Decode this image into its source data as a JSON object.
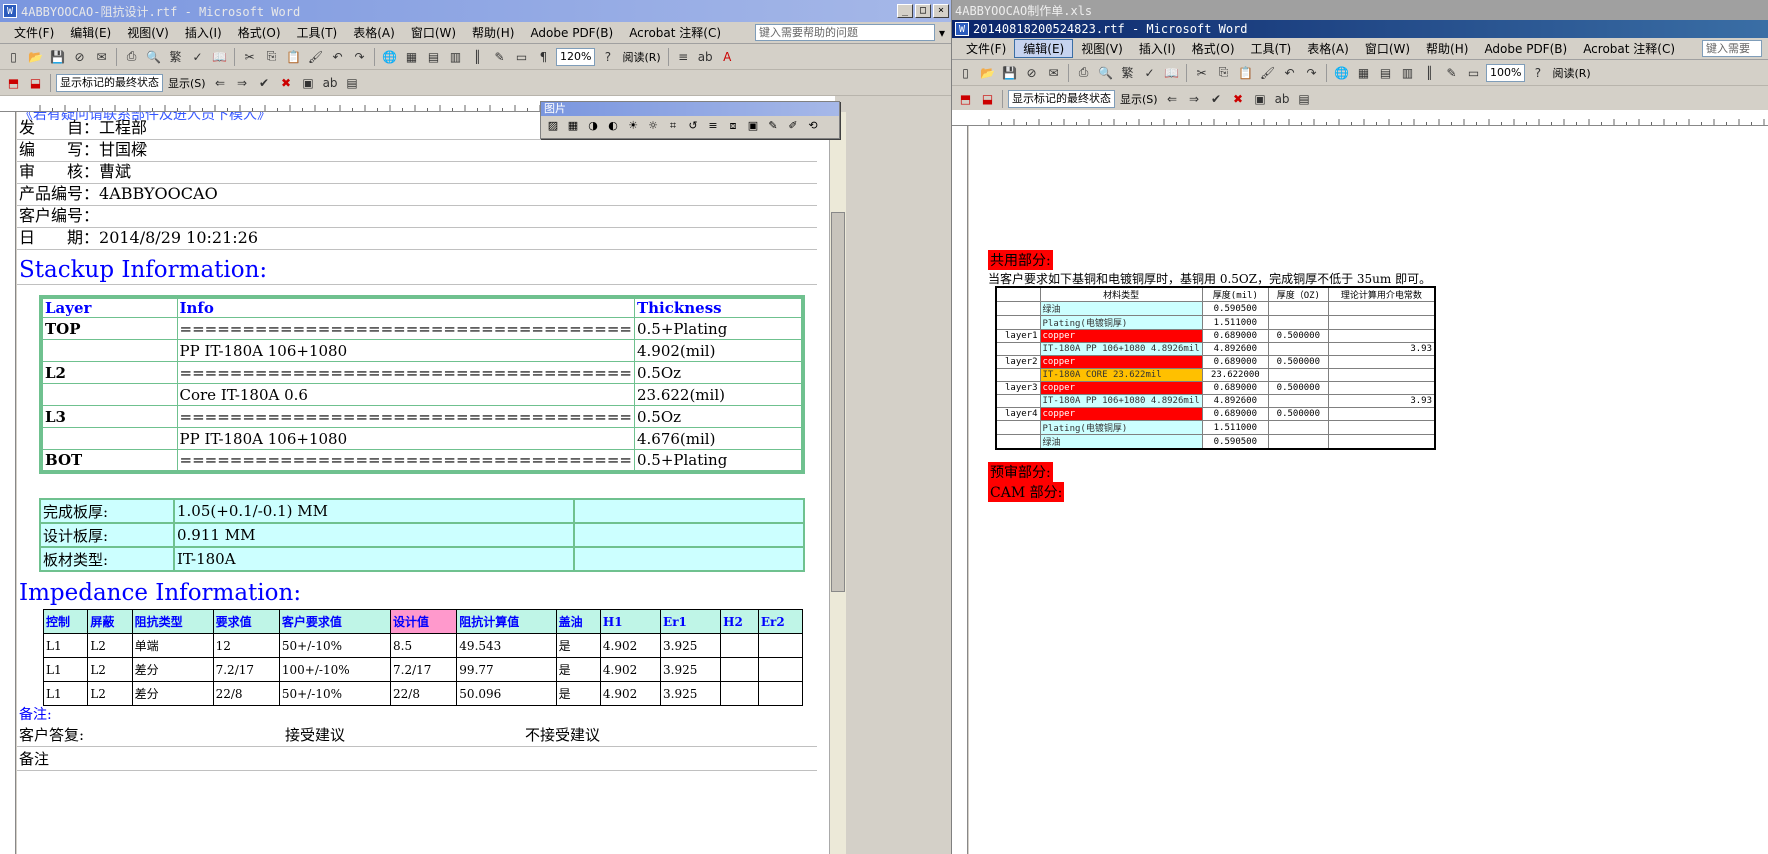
{
  "left": {
    "title": "4ABBYOOCAO-阻抗设计.rtf - Microsoft Word",
    "menu": [
      "文件(F)",
      "编辑(E)",
      "视图(V)",
      "插入(I)",
      "格式(O)",
      "工具(T)",
      "表格(A)",
      "窗口(W)",
      "帮助(H)",
      "Adobe PDF(B)",
      "Acrobat 注释(C)"
    ],
    "help_placeholder": "键入需要帮助的问题",
    "zoom": "120%",
    "read_label": "阅读(R)",
    "markup_state": "显示标记的最终状态",
    "show_label": "显示(S)",
    "top_cut": "《若有疑问请联系部件及进人员下模人》",
    "info": [
      {
        "label": "发　　自：",
        "value": "工程部"
      },
      {
        "label": "编　　写：",
        "value": "甘国樑"
      },
      {
        "label": "审　　核：",
        "value": "曹斌"
      },
      {
        "label": "产品编号：",
        "value": "4ABBYOOCAO"
      },
      {
        "label": "客户编号：",
        "value": ""
      },
      {
        "label": "日　　期：",
        "value": "2014/8/29 10:21:26"
      }
    ],
    "stackup_title": "Stackup Information:",
    "stackup_headers": [
      "Layer",
      "Info",
      "Thickness"
    ],
    "stackup_rows": [
      [
        "TOP",
        "====================================",
        "0.5+Plating"
      ],
      [
        "",
        "PP      IT-180A     106+1080",
        "4.902(mil)"
      ],
      [
        "L2",
        "====================================",
        "0.5Oz"
      ],
      [
        "",
        "Core      IT-180A     0.6",
        "23.622(mil)"
      ],
      [
        "L3",
        "====================================",
        "0.5Oz"
      ],
      [
        "",
        "PP      IT-180A     106+1080",
        "4.676(mil)"
      ],
      [
        "BOT",
        "====================================",
        "0.5+Plating"
      ]
    ],
    "board_rows": [
      [
        "完成板厚:",
        "1.05(+0.1/-0.1) MM",
        ""
      ],
      [
        "设计板厚:",
        "0.911 MM",
        ""
      ],
      [
        "板材类型:",
        "IT-180A",
        ""
      ]
    ],
    "impedance_title": "Impedance Information:",
    "imp_headers": [
      "控制",
      "屏蔽",
      "阻抗类型",
      "要求值",
      "客户要求值",
      "设计值",
      "阻抗计算值",
      "盖油",
      "H1",
      "Er1",
      "H2",
      "Er2"
    ],
    "imp_rows": [
      [
        "L1",
        "L2",
        "单端",
        "12",
        "50+/-10%",
        "8.5",
        "49.543",
        "是",
        "4.902",
        "3.925",
        "",
        ""
      ],
      [
        "L1",
        "L2",
        "差分",
        "7.2/17",
        "100+/-10%",
        "7.2/17",
        "99.77",
        "是",
        "4.902",
        "3.925",
        "",
        ""
      ],
      [
        "L1",
        "L2",
        "差分",
        "22/8",
        "50+/-10%",
        "22/8",
        "50.096",
        "是",
        "4.902",
        "3.925",
        "",
        ""
      ]
    ],
    "remark": "备注:",
    "reply_label": "客户答复:",
    "accept": "接受建议",
    "reject": "不接受建议",
    "remark2": "备注",
    "picture_toolbar_title": "图片"
  },
  "right": {
    "title": "20140818200524823.rtf - Microsoft Word",
    "bg_title": "4ABBYOOCAO制作单.xls",
    "menu": [
      "文件(F)",
      "编辑(E)",
      "视图(V)",
      "插入(I)",
      "格式(O)",
      "工具(T)",
      "表格(A)",
      "窗口(W)",
      "帮助(H)",
      "Adobe PDF(B)",
      "Acrobat 注释(C)"
    ],
    "help_placeholder": "键入需要",
    "zoom": "100%",
    "read_label": "阅读(R)",
    "markup_state": "显示标记的最终状态",
    "show_label": "显示(S)",
    "common_heading": "共用部分:",
    "common_text": "当客户要求如下基铜和电镀铜厚时，基铜用 0.5OZ，完成铜厚不低于 35um 即可。",
    "sheet_headers": [
      "",
      "材料类型",
      "厚度(mil)",
      "厚度（OZ)",
      "理论计算用介电常数"
    ],
    "sheet_rows": [
      {
        "c": [
          "",
          "绿油",
          "0.590500",
          "",
          ""
        ],
        "t": "cyan"
      },
      {
        "c": [
          "",
          "Plating(电镀铜厚)",
          "1.511000",
          "",
          ""
        ],
        "t": "cyan"
      },
      {
        "c": [
          "layer1",
          "copper",
          "0.689000",
          "0.500000",
          ""
        ],
        "t": "red"
      },
      {
        "c": [
          "",
          "IT-180A PP  106+1080  4.8926mil",
          "4.892600",
          "",
          "3.93"
        ],
        "t": "cyan"
      },
      {
        "c": [
          "layer2",
          "copper",
          "0.689000",
          "0.500000",
          ""
        ],
        "t": "red"
      },
      {
        "c": [
          "",
          "IT-180A CORE  23.622mil",
          "23.622000",
          "",
          ""
        ],
        "t": "orange"
      },
      {
        "c": [
          "layer3",
          "copper",
          "0.689000",
          "0.500000",
          ""
        ],
        "t": "red"
      },
      {
        "c": [
          "",
          "IT-180A PP  106+1080  4.8926mil",
          "4.892600",
          "",
          "3.93"
        ],
        "t": "cyan"
      },
      {
        "c": [
          "layer4",
          "copper",
          "0.689000",
          "0.500000",
          ""
        ],
        "t": "red"
      },
      {
        "c": [
          "",
          "Plating(电镀铜厚)",
          "1.511000",
          "",
          ""
        ],
        "t": "cyan"
      },
      {
        "c": [
          "",
          "绿油",
          "0.590500",
          "",
          ""
        ],
        "t": "cyan"
      }
    ],
    "review_heading": "预审部分:",
    "cam_heading": "CAM 部分:"
  },
  "colors": {
    "title_active": "#0a246a",
    "stack_border": "#6fc18f",
    "cyan": "#ccffff",
    "red": "#ff0000",
    "header_teal": "#bff5e7"
  }
}
